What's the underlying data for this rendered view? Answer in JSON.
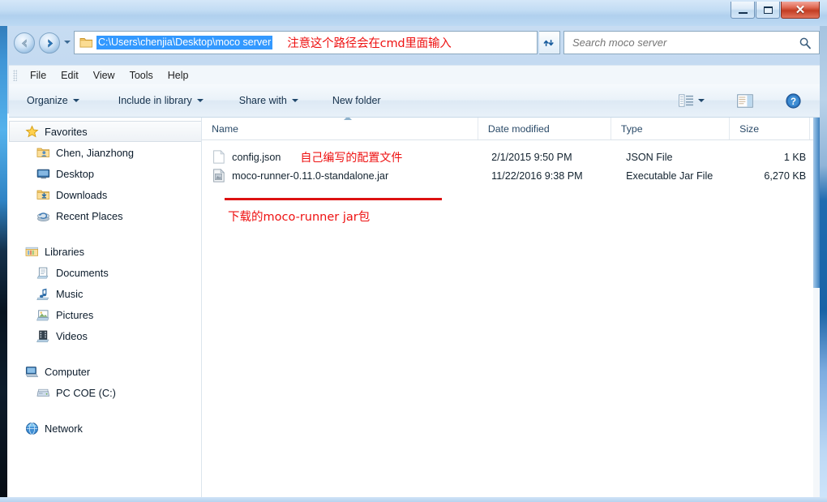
{
  "window": {
    "controls": {
      "minimize": "Minimize",
      "maximize": "Maximize",
      "close": "✕"
    }
  },
  "navigation": {
    "back_label": "Back",
    "forward_label": "Forward",
    "recent_pages_label": "Recent pages",
    "refresh_label": "Refresh"
  },
  "address_bar": {
    "path": "C:\\Users\\chenjia\\Desktop\\moco server",
    "path_selected": true,
    "annotation": "注意这个路径会在cmd里面输入",
    "folder_icon": "folder-icon"
  },
  "search": {
    "placeholder": "Search moco server",
    "value": "",
    "icon": "search-icon"
  },
  "menubar": {
    "items": [
      {
        "label": "File"
      },
      {
        "label": "Edit"
      },
      {
        "label": "View"
      },
      {
        "label": "Tools"
      },
      {
        "label": "Help"
      }
    ]
  },
  "toolbar": {
    "buttons": [
      {
        "label": "Organize",
        "has_caret": true
      },
      {
        "label": "Include in library",
        "has_caret": true
      },
      {
        "label": "Share with",
        "has_caret": true
      },
      {
        "label": "New folder",
        "has_caret": false
      }
    ],
    "view_icon": "view-list-icon",
    "view_caret": "chevron-down-icon",
    "preview_pane_icon": "preview-pane-icon",
    "help_icon": "help-icon"
  },
  "sidebar": {
    "groups": [
      {
        "header": {
          "label": "Favorites",
          "icon": "star-icon",
          "selected": true
        },
        "items": [
          {
            "label": "Chen, Jianzhong",
            "icon": "user-folder-icon"
          },
          {
            "label": "Desktop",
            "icon": "desktop-icon"
          },
          {
            "label": "Downloads",
            "icon": "downloads-folder-icon"
          },
          {
            "label": "Recent Places",
            "icon": "recent-places-icon"
          }
        ]
      },
      {
        "header": {
          "label": "Libraries",
          "icon": "libraries-icon",
          "selected": false
        },
        "items": [
          {
            "label": "Documents",
            "icon": "documents-icon"
          },
          {
            "label": "Music",
            "icon": "music-icon"
          },
          {
            "label": "Pictures",
            "icon": "pictures-icon"
          },
          {
            "label": "Videos",
            "icon": "videos-icon"
          }
        ]
      },
      {
        "header": {
          "label": "Computer",
          "icon": "computer-icon",
          "selected": false
        },
        "items": [
          {
            "label": "PC COE (C:)",
            "icon": "hard-drive-icon"
          }
        ]
      },
      {
        "header": {
          "label": "Network",
          "icon": "network-icon",
          "selected": false
        },
        "items": []
      }
    ]
  },
  "file_list": {
    "columns": [
      {
        "key": "name",
        "label": "Name",
        "sorted": "asc"
      },
      {
        "key": "date",
        "label": "Date modified",
        "sorted": null
      },
      {
        "key": "type",
        "label": "Type",
        "sorted": null
      },
      {
        "key": "size",
        "label": "Size",
        "sorted": null
      }
    ],
    "rows": [
      {
        "name": "config.json",
        "date": "2/1/2015 9:50 PM",
        "type": "JSON File",
        "size": "1 KB",
        "icon": "json-file-icon",
        "annotation": "自己编写的配置文件"
      },
      {
        "name": "moco-runner-0.11.0-standalone.jar",
        "date": "11/22/2016 9:38 PM",
        "type": "Executable Jar File",
        "size": "6,270 KB",
        "icon": "jar-file-icon",
        "annotation": ""
      }
    ],
    "below_annotation": "下载的moco-runner  jar包"
  },
  "colors": {
    "annotation_red": "#ee1111",
    "selection_blue": "#3399ff",
    "close_button_red": "#c23c22",
    "scrollbar_blue": "#3f7fbd"
  }
}
